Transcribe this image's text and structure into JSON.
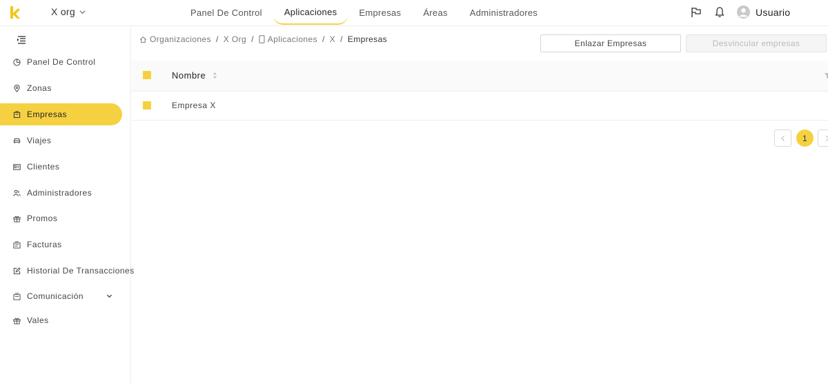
{
  "app": {
    "org_name": "X org",
    "accent_color": "#f5d142"
  },
  "topnav": {
    "items": [
      {
        "label": "Panel De Control"
      },
      {
        "label": "Aplicaciones"
      },
      {
        "label": "Empresas"
      },
      {
        "label": "Áreas"
      },
      {
        "label": "Administradores"
      }
    ],
    "active": "Aplicaciones"
  },
  "user": {
    "name": "Usuario"
  },
  "sidebar": {
    "items": [
      {
        "label": "Panel De Control",
        "icon": "pie-chart-icon"
      },
      {
        "label": "Zonas",
        "icon": "location-pin-icon"
      },
      {
        "label": "Empresas",
        "icon": "building-icon"
      },
      {
        "label": "Viajes",
        "icon": "car-icon"
      },
      {
        "label": "Clientes",
        "icon": "id-card-icon"
      },
      {
        "label": "Administradores",
        "icon": "users-icon"
      },
      {
        "label": "Promos",
        "icon": "gift-icon"
      },
      {
        "label": "Facturas",
        "icon": "invoice-icon"
      },
      {
        "label": "Historial De Transacciones",
        "icon": "edit-icon"
      },
      {
        "label": "Comunicación",
        "icon": "message-icon"
      },
      {
        "label": "Vales",
        "icon": "gift-icon"
      }
    ],
    "active": "Empresas"
  },
  "breadcrumb": {
    "items": [
      {
        "label": "Organizaciones"
      },
      {
        "label": "X Org"
      },
      {
        "label": "Aplicaciones"
      },
      {
        "label": "X"
      },
      {
        "label": "Empresas"
      }
    ],
    "separator": "/"
  },
  "actions": {
    "link_label": "Enlazar Empresas",
    "unlink_label": "Desvincular empresas"
  },
  "table": {
    "columns": [
      {
        "label": "Nombre"
      }
    ],
    "rows": [
      {
        "name": "Empresa X"
      }
    ]
  },
  "pagination": {
    "current_page": "1"
  }
}
